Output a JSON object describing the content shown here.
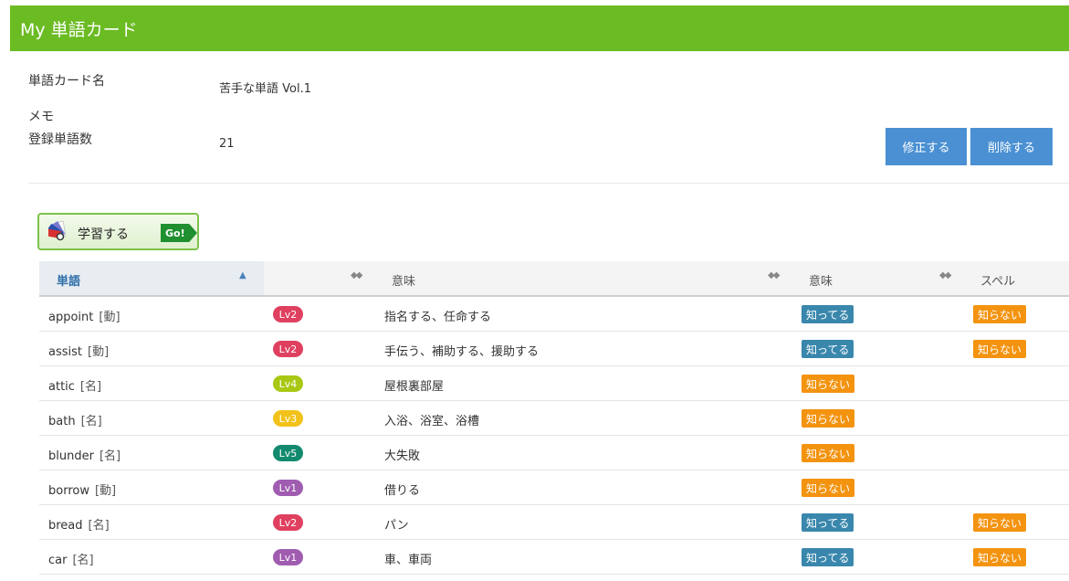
{
  "header": {
    "title": "My 単語カード"
  },
  "info": {
    "name_label": "単語カード名",
    "name_value": "苦手な単語 Vol.1",
    "memo_label": "メモ",
    "count_label": "登録単語数",
    "count_value": "21"
  },
  "actions": {
    "edit_label": "修正する",
    "delete_label": "削除する"
  },
  "study": {
    "label": "学習する",
    "go_label": "Go!"
  },
  "table": {
    "columns": [
      "単語",
      "",
      "意味",
      "意味",
      "スペル"
    ],
    "rows": [
      {
        "word": "appoint",
        "pos": "[動]",
        "level": "Lv2",
        "meaning": "指名する、任命する",
        "know": "知ってる",
        "spell": "知らない"
      },
      {
        "word": "assist",
        "pos": "[動]",
        "level": "Lv2",
        "meaning": "手伝う、補助する、援助する",
        "know": "知ってる",
        "spell": "知らない"
      },
      {
        "word": "attic",
        "pos": "[名]",
        "level": "Lv4",
        "meaning": "屋根裏部屋",
        "know": "知らない",
        "spell": ""
      },
      {
        "word": "bath",
        "pos": "[名]",
        "level": "Lv3",
        "meaning": "入浴、浴室、浴槽",
        "know": "知らない",
        "spell": ""
      },
      {
        "word": "blunder",
        "pos": "[名]",
        "level": "Lv5",
        "meaning": "大失敗",
        "know": "知らない",
        "spell": ""
      },
      {
        "word": "borrow",
        "pos": "[動]",
        "level": "Lv1",
        "meaning": "借りる",
        "know": "知らない",
        "spell": ""
      },
      {
        "word": "bread",
        "pos": "[名]",
        "level": "Lv2",
        "meaning": "パン",
        "know": "知ってる",
        "spell": "知らない"
      },
      {
        "word": "car",
        "pos": "[名]",
        "level": "Lv1",
        "meaning": "車、車両",
        "know": "知ってる",
        "spell": "知らない"
      }
    ]
  },
  "colors": {
    "header_green": "#6bbb23",
    "button_blue": "#4a90d2",
    "know_blue": "#3a87ad",
    "dont_know_orange": "#f3930f",
    "level_colors": {
      "Lv1": "#a05cb0",
      "Lv2": "#e0405f",
      "Lv3": "#f2c21b",
      "Lv4": "#a8c814",
      "Lv5": "#138a6e"
    }
  }
}
